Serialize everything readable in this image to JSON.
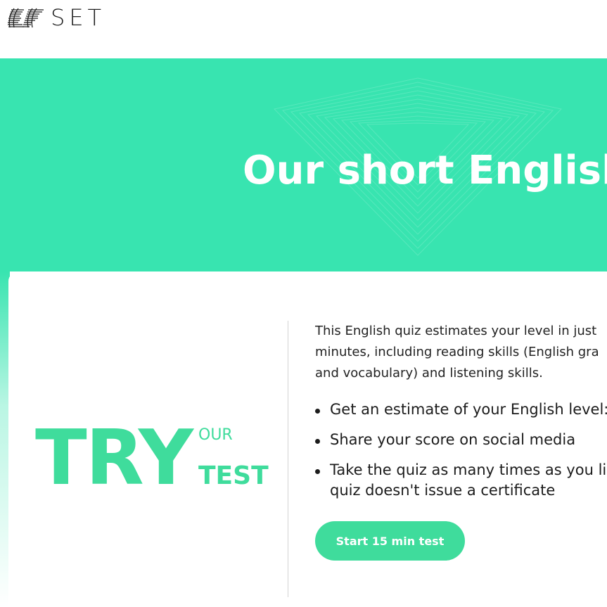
{
  "header": {
    "logo_text": "SET",
    "logo_icon": "ef-logo-mark"
  },
  "hero": {
    "title": "Our short English"
  },
  "promo": {
    "try": "TRY",
    "our": "OUR",
    "test": "TEST"
  },
  "description": {
    "lines": [
      "This English quiz estimates your level in just",
      "minutes, including reading skills (English gra",
      "and vocabulary) and listening skills."
    ]
  },
  "bullets": [
    {
      "lines": [
        "Get an estimate of your English level:"
      ]
    },
    {
      "lines": [
        "Share your score on social media"
      ]
    },
    {
      "lines": [
        "Take the quiz as many times as you li",
        "quiz doesn't issue a certificate"
      ]
    }
  ],
  "cta": {
    "label": "Start 15 min test"
  },
  "colors": {
    "hero_bg": "#38e4b0",
    "accent": "#3fdc9c",
    "text": "#222222"
  }
}
